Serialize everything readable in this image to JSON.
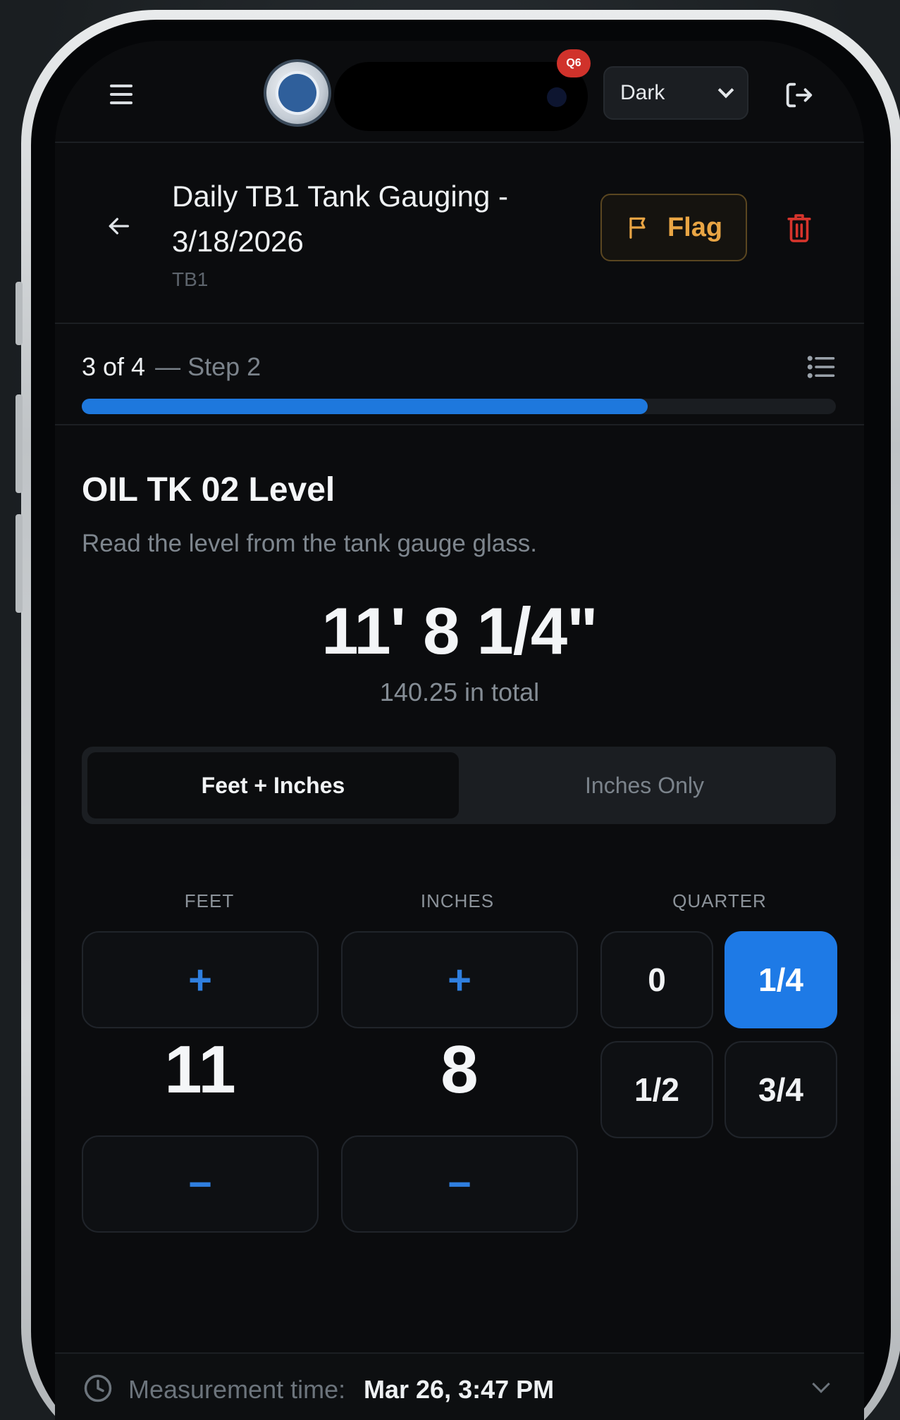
{
  "topbar": {
    "notification_badge": "Q6",
    "theme_select": {
      "value": "Dark"
    }
  },
  "header": {
    "title": "Daily TB1 Tank Gauging - 3/18/2026",
    "subtitle": "TB1",
    "flag_label": "Flag"
  },
  "progress": {
    "counter": "3 of 4",
    "step": "— Step 2",
    "fraction": 0.75
  },
  "item": {
    "title": "OIL TK 02 Level",
    "description": "Read the level from the tank gauge glass.",
    "reading": "11' 8 1/4\"",
    "total": "140.25 in total"
  },
  "mode_toggle": {
    "options": [
      "Feet + Inches",
      "Inches Only"
    ],
    "selected": "Feet + Inches"
  },
  "inputs": {
    "feet": {
      "label": "FEET",
      "value": "11",
      "plus": "+",
      "minus": "−"
    },
    "inches": {
      "label": "INCHES",
      "value": "8",
      "plus": "+",
      "minus": "−"
    },
    "quarter": {
      "label": "QUARTER",
      "options": [
        "0",
        "1/4",
        "1/2",
        "3/4"
      ],
      "selected": "1/4"
    }
  },
  "footer": {
    "measurement_label": "Measurement time:",
    "measurement_value": "Mar 26, 3:47 PM"
  },
  "colors": {
    "accent": "#1e7ae6",
    "flag": "#e9a544",
    "danger": "#d6342c",
    "background": "#0b0c0e"
  },
  "icons": [
    "menu-icon",
    "logo",
    "chevron-down-icon",
    "logout-icon",
    "back-arrow-icon",
    "flag-icon",
    "trash-icon",
    "list-icon",
    "clock-icon"
  ]
}
